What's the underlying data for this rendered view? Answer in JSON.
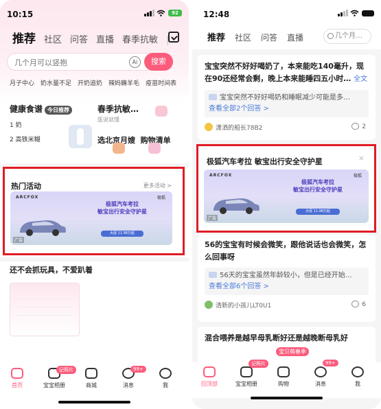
{
  "left": {
    "status": {
      "time": "10:15",
      "battery": "92"
    },
    "tabs": [
      "推荐",
      "社区",
      "问答",
      "直播",
      "春季抗敏"
    ],
    "search": {
      "placeholder": "几个月可以竖抱",
      "button": "搜索",
      "ai": "Ai"
    },
    "quick_links": [
      "月子中心",
      "奶水量不足",
      "开奶追奶",
      "辣妈薅羊毛",
      "疫苗时间表"
    ],
    "diet": {
      "title": "健康食谱",
      "badge": "今日推荐",
      "items": [
        "1  奶",
        "2  高铁米糊"
      ]
    },
    "promo": {
      "title": "春季抗敏…",
      "subtitle": "医说就懂",
      "title2": "选北京月嫂",
      "title3": "购物清单"
    },
    "hot": {
      "title": "热门活动",
      "more": "更多活动 >"
    },
    "ad": {
      "brand": "ARCFOX",
      "headline": "极狐汽车考拉\n敏宝出行安全守护星",
      "cta": "大促 11.98万起",
      "tag": "广告",
      "logo": "极狐"
    },
    "feed_title": "还不会抓玩具，不爱趴着",
    "tabbar": {
      "home": "首页",
      "album": "宝宝相册",
      "shop": "商城",
      "msg": "消息",
      "me": "我",
      "album_pill": "记照片",
      "msg_pill": "99+"
    }
  },
  "right": {
    "status": {
      "time": "12:48"
    },
    "tabs": [
      "推荐",
      "社区",
      "问答",
      "直播"
    ],
    "search_placeholder": "几个月…",
    "card1": {
      "question": "宝宝突然不好好喝奶了，本来能吃140毫升，现在90还经常会剩，晚上本来能睡四五小时…",
      "full": "全文",
      "quote": "宝宝突然不好好喝奶和睡眠减少可能是多…",
      "answers": "查看全部2个回答 >",
      "author": "潇洒的船长78B2",
      "count": "2"
    },
    "ad": {
      "title": "极狐汽车考拉 敏宝出行安全守护星",
      "close": "×"
    },
    "card2": {
      "question": "56的宝宝有时候会微笑，跟他说话也会微笑，怎么回事呀",
      "quote": "56天的宝宝虽然年龄较小，但是已经开始…",
      "answers": "查看全部6个回答 >",
      "author": "清新的小孩儿LT0U1",
      "count": "6"
    },
    "card3": {
      "question": "混合喂养是越早母乳断好还是越晚断母乳好"
    },
    "tabbar": {
      "home": "回顶部",
      "album": "宝宝相册",
      "shop": "购物",
      "msg": "消息",
      "me": "我",
      "album_pill": "记照片",
      "msg_pill": "99+",
      "float": "宝贝萌春季"
    }
  },
  "colors": {
    "accent": "#fb5c7c",
    "highlight": "#e01b24",
    "link": "#4a7ad9"
  }
}
